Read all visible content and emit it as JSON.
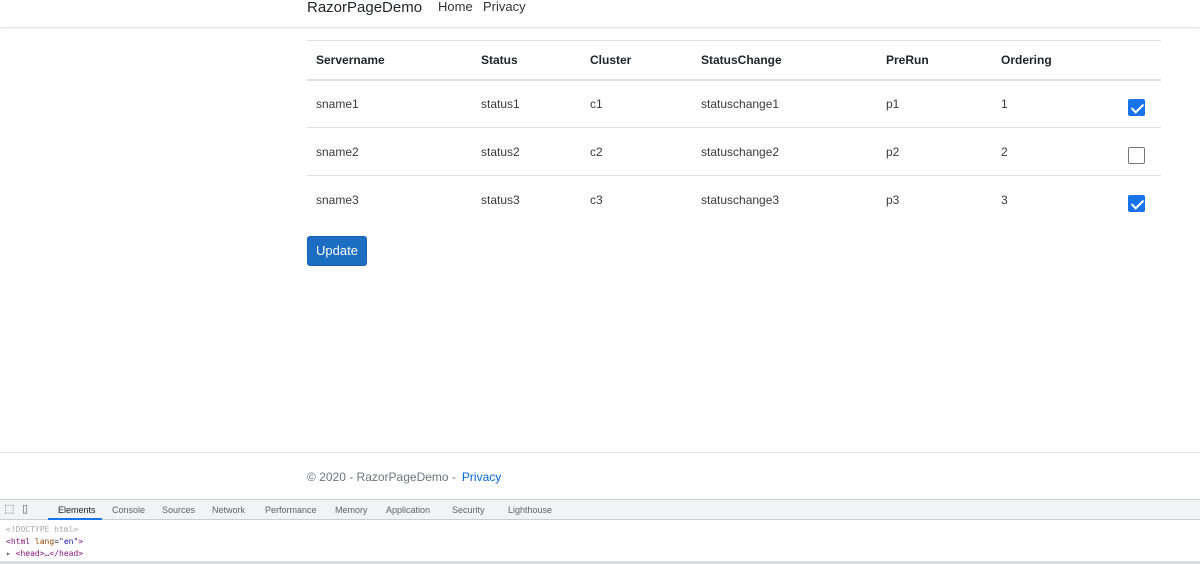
{
  "navbar": {
    "brand": "RazorPageDemo",
    "links": [
      "Home",
      "Privacy"
    ]
  },
  "table": {
    "headers": [
      "Servername",
      "Status",
      "Cluster",
      "StatusChange",
      "PreRun",
      "Ordering",
      ""
    ],
    "rows": [
      {
        "servername": "sname1",
        "status": "status1",
        "cluster": "c1",
        "statuschange": "statuschange1",
        "prerun": "p1",
        "ordering": "1",
        "checked": true
      },
      {
        "servername": "sname2",
        "status": "status2",
        "cluster": "c2",
        "statuschange": "statuschange2",
        "prerun": "p2",
        "ordering": "2",
        "checked": false
      },
      {
        "servername": "sname3",
        "status": "status3",
        "cluster": "c3",
        "statuschange": "statuschange3",
        "prerun": "p3",
        "ordering": "3",
        "checked": true
      }
    ]
  },
  "update_button": "Update",
  "footer": {
    "text": "© 2020 - RazorPageDemo -",
    "link": "Privacy"
  },
  "devtools": {
    "tabs": [
      "Elements",
      "Console",
      "Sources",
      "Network",
      "Performance",
      "Memory",
      "Application",
      "Security",
      "Lighthouse"
    ],
    "active_tab": "Elements",
    "lines": {
      "doctype": "<!DOCTYPE html>",
      "html_open": "<html",
      "html_attr": "lang",
      "html_val": "\"en\"",
      "html_close": ">",
      "head": "<head>…</head>"
    }
  },
  "colors": {
    "primary_button": "#1b6ec2",
    "checkbox_checked": "#1a73e8",
    "footer_link": "#0366d6"
  }
}
